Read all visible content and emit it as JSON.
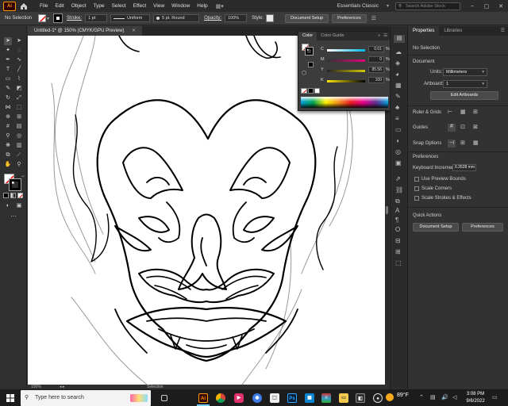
{
  "menubar": {
    "logo": "Ai",
    "items": [
      "File",
      "Edit",
      "Object",
      "Type",
      "Select",
      "Effect",
      "View",
      "Window",
      "Help"
    ],
    "workspace": "Essentials Classic",
    "search_placeholder": "Search Adobe Stock"
  },
  "control_bar": {
    "selection_status": "No Selection",
    "stroke_label": "Stroke:",
    "stroke_value": "1 pt",
    "profile_value": "Uniform",
    "brush_value": "5 pt. Round",
    "opacity_label": "Opacity:",
    "opacity_value": "100%",
    "style_label": "Style:",
    "document_setup": "Document Setup",
    "preferences": "Preferences"
  },
  "document": {
    "tab_title": "Untitled-1* @ 150% (CMYK/GPU Preview)",
    "zoom": "150%",
    "status_tool": "Selection"
  },
  "color_panel": {
    "tabs": [
      "Color",
      "Color Guide"
    ],
    "sliders": [
      {
        "label": "C",
        "value": "0.01",
        "color": "#00b6e6"
      },
      {
        "label": "M",
        "value": "0",
        "color": "#e6007e"
      },
      {
        "label": "Y",
        "value": "85.56",
        "color": "#ffe500"
      },
      {
        "label": "K",
        "value": "100",
        "color": "#000000"
      }
    ]
  },
  "properties": {
    "tabs": [
      "Properties",
      "Libraries"
    ],
    "selection": "No Selection",
    "document_heading": "Document",
    "units_label": "Units:",
    "units_value": "Millimeters",
    "artboard_label": "Artboard:",
    "artboard_value": "1",
    "edit_artboards": "Edit Artboards",
    "rulers_grids": "Ruler & Grids",
    "guides": "Guides",
    "snap_options": "Snap Options",
    "preferences_heading": "Preferences",
    "keyboard_increment_label": "Keyboard Increment:",
    "keyboard_increment_value": "0.3528 mm",
    "checkboxes": [
      "Use Preview Bounds",
      "Scale Corners",
      "Scale Strokes & Effects"
    ],
    "quick_actions": "Quick Actions",
    "document_setup": "Document Setup",
    "preferences": "Preferences"
  },
  "taskbar": {
    "search_placeholder": "Type here to search",
    "weather": "89°F",
    "time": "3:08 PM",
    "date": "9/6/2022"
  }
}
